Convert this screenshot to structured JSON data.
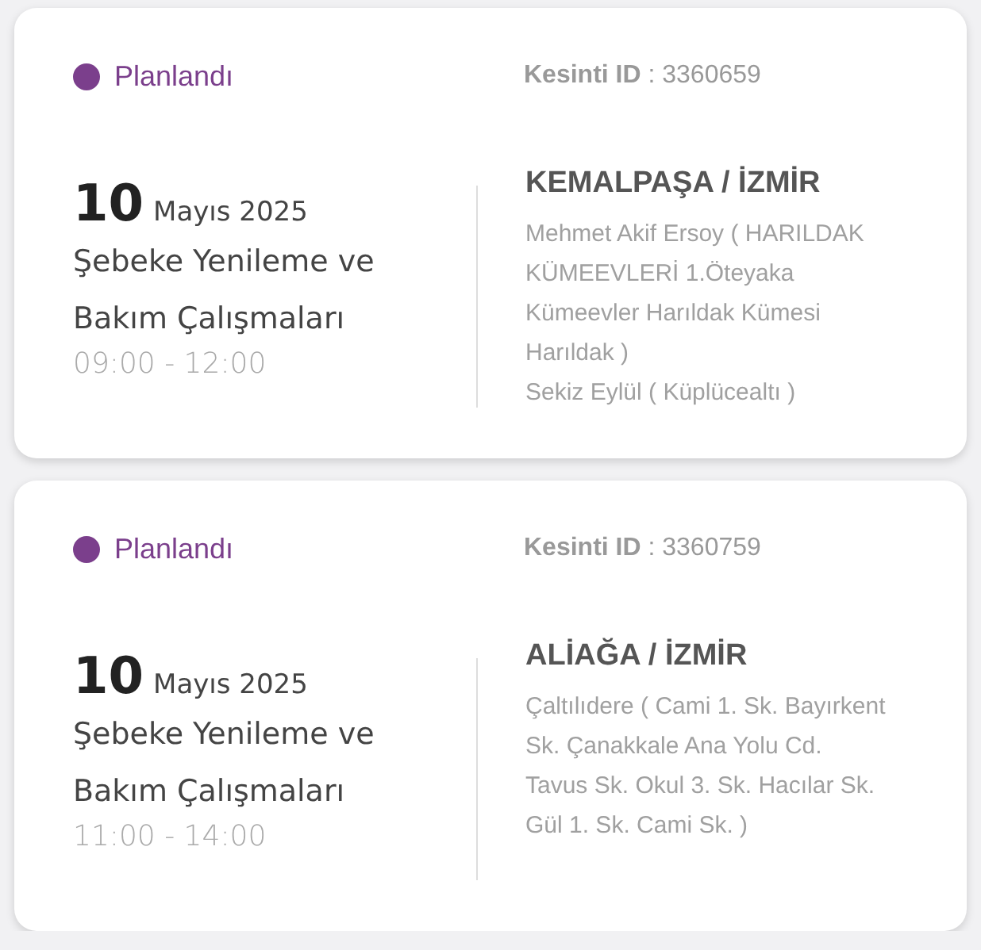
{
  "outages": [
    {
      "status": "Planlandı",
      "outage_id": "**Kesinti ID** : 3360659",
      "day": "10",
      "month_year": "Mayıs 2025",
      "title": "Şebeke Yenileme ve Bakım Çalışmaları",
      "time": "09:00 - 12:00",
      "location": "KEMALPAŞA / İZMİR",
      "address_lines": [
        "Mehmet Akif Ersoy ( HARILDAK",
        "KÜMEEVLERİ 1.Öteyaka",
        "Kümeevler Harıldak Kümesi",
        "Harıldak )",
        "Sekiz Eylül ( Küplücealtı )"
      ]
    },
    {
      "status": "Planlandı",
      "outage_id": "**Kesinti ID** : 3360759",
      "day": "10",
      "month_year": "Mayıs 2025",
      "title": "Şebeke Yenileme ve Bakım Çalışmaları",
      "time": "11:00 - 14:00",
      "location": "ALİAĞA / İZMİR",
      "address_lines": [
        "Çaltılıdere ( Cami 1. Sk. Bayırkent",
        "Sk. Çanakkale Ana Yolu Cd.",
        "Tavus Sk. Okul 3. Sk. Hacılar Sk.",
        "Gül 1. Sk. Cami Sk. )"
      ]
    }
  ]
}
